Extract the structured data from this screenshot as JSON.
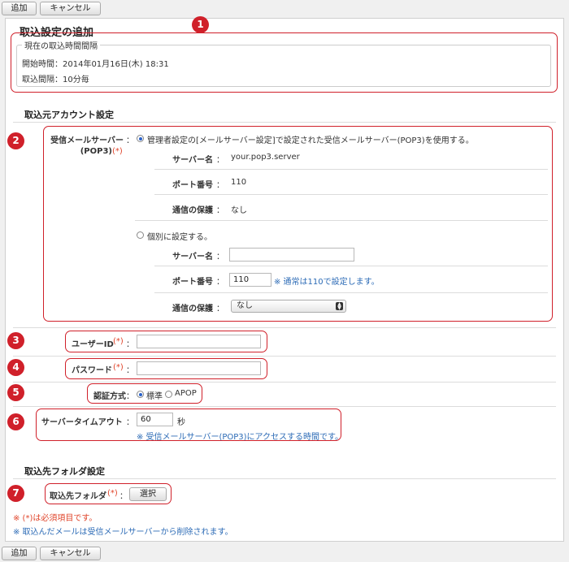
{
  "toolbar": {
    "add_label": "追加",
    "cancel_label": "キャンセル"
  },
  "page_title": "取込設定の追加",
  "interval_box": {
    "legend": "現在の取込時間間隔",
    "start_time": "開始時間：2014年01月16日(木) 18:31",
    "interval": "取込間隔：10分毎"
  },
  "source_section": {
    "title": "取込元アカウント設定",
    "incoming_label_line1": "受信メールサーバー",
    "incoming_label_line2": "(POP3)",
    "required_mark": "(*)",
    "colon": "：",
    "option_admin": "管理者設定の[メールサーバー設定]で設定された受信メールサーバー(POP3)を使用する。",
    "admin_server_label": "サーバー名",
    "admin_server_value": "your.pop3.server",
    "admin_port_label": "ポート番号",
    "admin_port_value": "110",
    "admin_security_label": "通信の保護",
    "admin_security_value": "なし",
    "option_custom": "個別に設定する。",
    "custom_server_label": "サーバー名",
    "custom_server_value": "",
    "custom_port_label": "ポート番号",
    "custom_port_value": "110",
    "custom_port_note": "※ 通常は110で設定します。",
    "custom_security_label": "通信の保護",
    "custom_security_value": "なし",
    "userid_label": "ユーザーID",
    "userid_value": "",
    "password_label": "パスワード",
    "password_value": "",
    "auth_label": "認証方式",
    "auth_standard": "標準",
    "auth_apop": "APOP",
    "timeout_label": "サーバータイムアウト",
    "timeout_value": "60",
    "timeout_unit": "秒",
    "timeout_note": "※ 受信メールサーバー(POP3)にアクセスする時間です。"
  },
  "dest_section": {
    "title": "取込先フォルダ設定",
    "folder_label": "取込先フォルダ",
    "select_button": "選択"
  },
  "footer_notes": {
    "required_note": "※ (*)は必須項目です。",
    "delete_note": "※ 取込んだメールは受信メールサーバーから削除されます。"
  },
  "badges": [
    "1",
    "2",
    "3",
    "4",
    "5",
    "6",
    "7"
  ],
  "colors": {
    "highlight": "#d0202a",
    "required": "#e0442a",
    "note": "#2c6bb6"
  }
}
